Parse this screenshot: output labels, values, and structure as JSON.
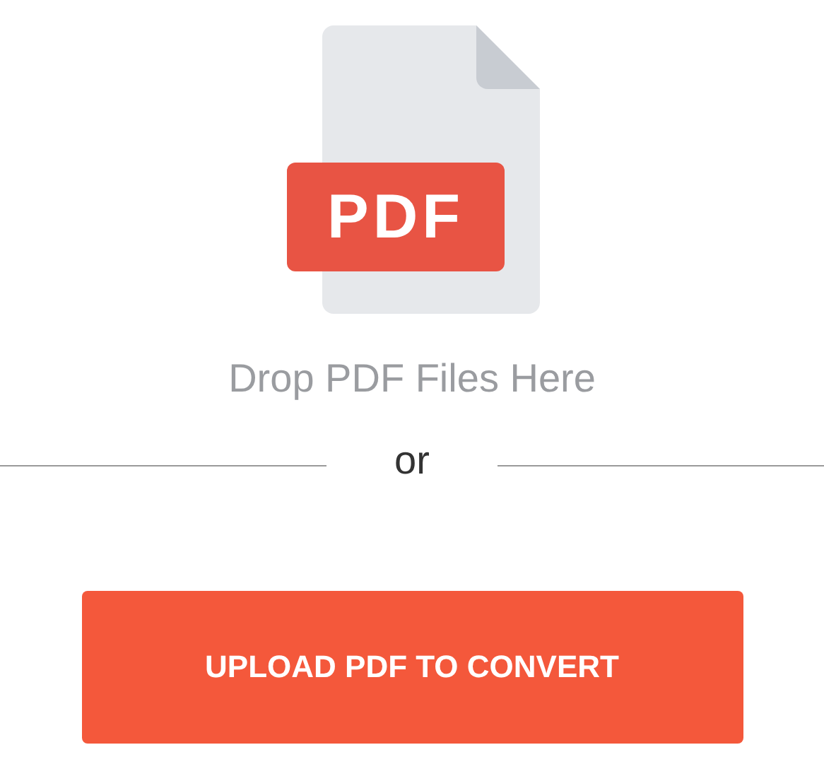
{
  "file_badge": "PDF",
  "drop_hint": "Drop PDF Files Here",
  "separator": "or",
  "upload_button": "UPLOAD PDF TO CONVERT"
}
